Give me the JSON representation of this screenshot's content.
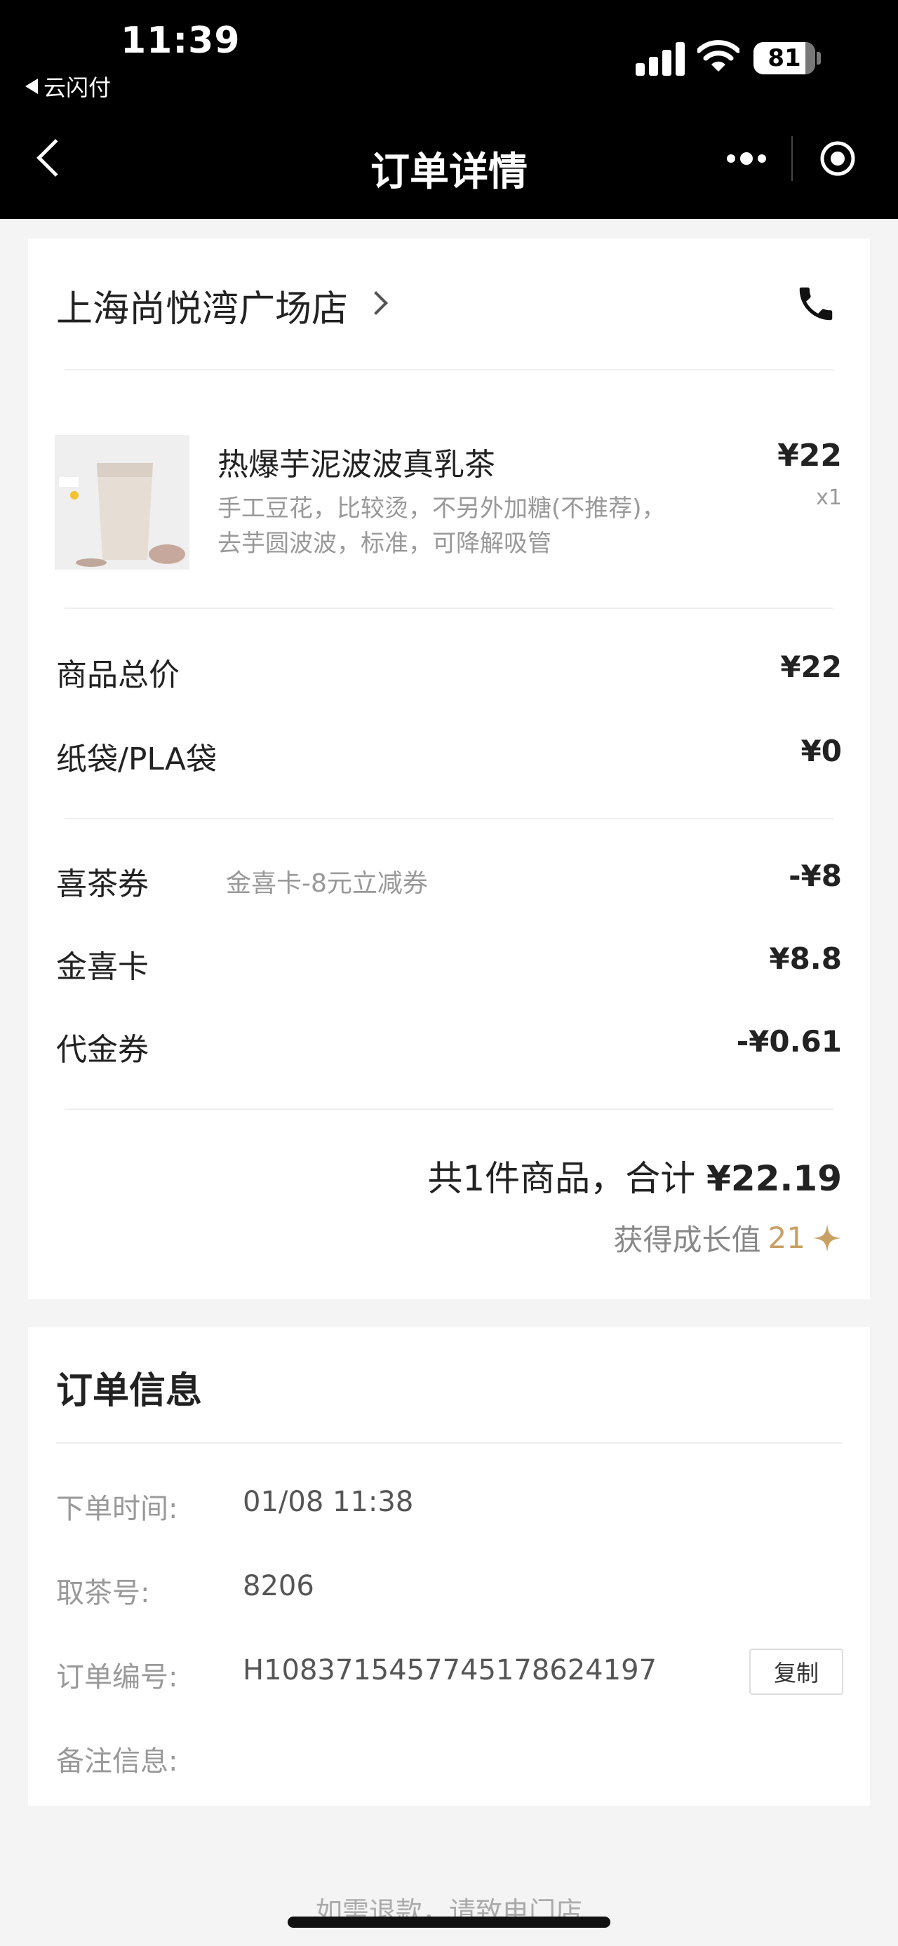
{
  "status_bar": {
    "time": "11:39",
    "back_app": "云闪付",
    "battery": "81"
  },
  "nav": {
    "title": "订单详情"
  },
  "store": {
    "name": "上海尚悦湾广场店"
  },
  "product": {
    "name": "热爆芋泥波波真乳茶",
    "options_line1": "手工豆花，比较烫，不另外加糖(不推荐)，",
    "options_line2": "去芋圆波波，标准，可降解吸管",
    "price": "¥22",
    "qty": "x1"
  },
  "summary": {
    "goods_total_label": "商品总价",
    "goods_total_value": "¥22",
    "bag_label": "纸袋/PLA袋",
    "bag_value": "¥0",
    "coupon_label": "喜茶券",
    "coupon_desc": "金喜卡-8元立减券",
    "coupon_value": "-¥8",
    "card_label": "金喜卡",
    "card_value": "¥8.8",
    "voucher_label": "代金券",
    "voucher_value": "-¥0.61",
    "total_prefix": "共1件商品，合计",
    "total_value": "¥22.19",
    "growth_label": "获得成长值",
    "growth_value": "21"
  },
  "order_info": {
    "title": "订单信息",
    "time_label": "下单时间:",
    "time_value": "01/08 11:38",
    "pickup_label": "取茶号:",
    "pickup_value": "8206",
    "order_no_label": "订单编号:",
    "order_no_value": "H1083715457745178624197",
    "copy_label": "复制",
    "remark_label": "备注信息:"
  },
  "footer": {
    "refund_note": "如需退款，请致电门店"
  },
  "colors": {
    "accent_gold": "#c8a064",
    "topbar": "#000000"
  }
}
